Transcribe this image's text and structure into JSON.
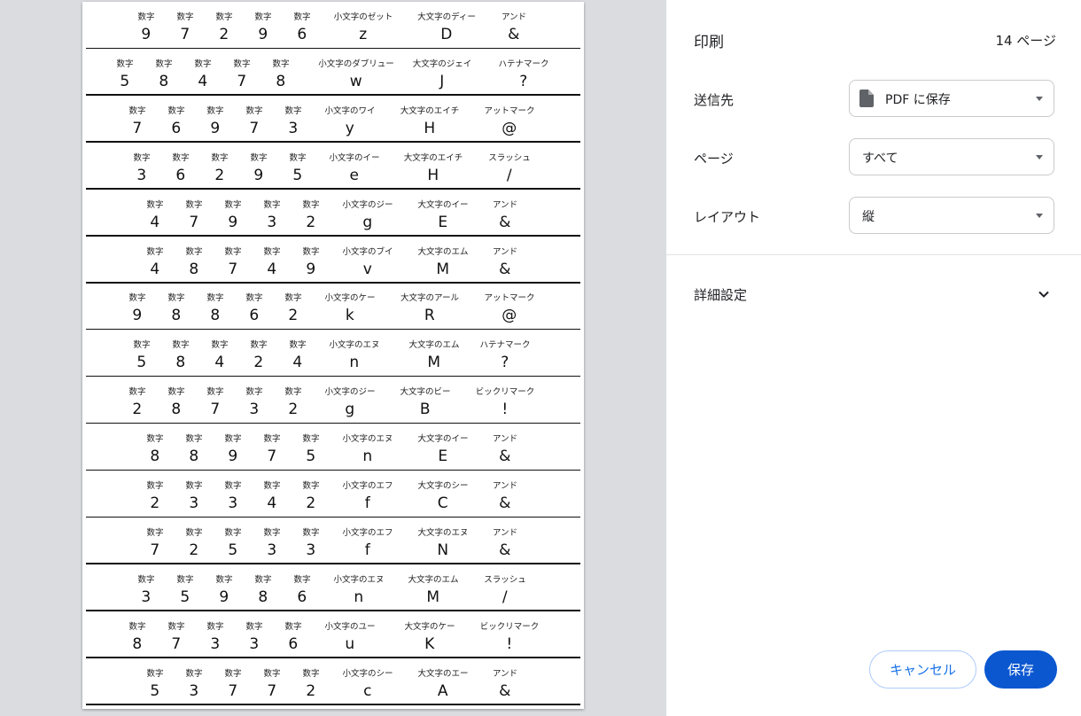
{
  "preview": {
    "rows": [
      {
        "cells": [
          {
            "label": "数字",
            "char": "9"
          },
          {
            "label": "数字",
            "char": "7"
          },
          {
            "label": "数字",
            "char": "2"
          },
          {
            "label": "数字",
            "char": "9"
          },
          {
            "label": "数字",
            "char": "6"
          },
          {
            "label": "小文字のゼット",
            "char": "z"
          },
          {
            "label": "大文字のディー",
            "char": "D"
          },
          {
            "label": "アンド",
            "char": "&"
          }
        ]
      },
      {
        "cells": [
          {
            "label": "数字",
            "char": "5"
          },
          {
            "label": "数字",
            "char": "8"
          },
          {
            "label": "数字",
            "char": "4"
          },
          {
            "label": "数字",
            "char": "7"
          },
          {
            "label": "数字",
            "char": "8"
          },
          {
            "label": "小文字のダブリュー",
            "char": "w"
          },
          {
            "label": "大文字のジェイ",
            "char": "J"
          },
          {
            "label": "ハテナマーク",
            "char": "?"
          }
        ]
      },
      {
        "cells": [
          {
            "label": "数字",
            "char": "7"
          },
          {
            "label": "数字",
            "char": "6"
          },
          {
            "label": "数字",
            "char": "9"
          },
          {
            "label": "数字",
            "char": "7"
          },
          {
            "label": "数字",
            "char": "3"
          },
          {
            "label": "小文字のワイ",
            "char": "y"
          },
          {
            "label": "大文字のエイチ",
            "char": "H"
          },
          {
            "label": "アットマーク",
            "char": "@"
          }
        ]
      },
      {
        "cells": [
          {
            "label": "数字",
            "char": "3"
          },
          {
            "label": "数字",
            "char": "6"
          },
          {
            "label": "数字",
            "char": "2"
          },
          {
            "label": "数字",
            "char": "9"
          },
          {
            "label": "数字",
            "char": "5"
          },
          {
            "label": "小文字のイー",
            "char": "e"
          },
          {
            "label": "大文字のエイチ",
            "char": "H"
          },
          {
            "label": "スラッシュ",
            "char": "/"
          }
        ]
      },
      {
        "cells": [
          {
            "label": "数字",
            "char": "4"
          },
          {
            "label": "数字",
            "char": "7"
          },
          {
            "label": "数字",
            "char": "9"
          },
          {
            "label": "数字",
            "char": "3"
          },
          {
            "label": "数字",
            "char": "2"
          },
          {
            "label": "小文字のジー",
            "char": "g"
          },
          {
            "label": "大文字のイー",
            "char": "E"
          },
          {
            "label": "アンド",
            "char": "&"
          }
        ]
      },
      {
        "cells": [
          {
            "label": "数字",
            "char": "4"
          },
          {
            "label": "数字",
            "char": "8"
          },
          {
            "label": "数字",
            "char": "7"
          },
          {
            "label": "数字",
            "char": "4"
          },
          {
            "label": "数字",
            "char": "9"
          },
          {
            "label": "小文字のブイ",
            "char": "v"
          },
          {
            "label": "大文字のエム",
            "char": "M"
          },
          {
            "label": "アンド",
            "char": "&"
          }
        ]
      },
      {
        "cells": [
          {
            "label": "数字",
            "char": "9"
          },
          {
            "label": "数字",
            "char": "8"
          },
          {
            "label": "数字",
            "char": "8"
          },
          {
            "label": "数字",
            "char": "6"
          },
          {
            "label": "数字",
            "char": "2"
          },
          {
            "label": "小文字のケー",
            "char": "k"
          },
          {
            "label": "大文字のアール",
            "char": "R"
          },
          {
            "label": "アットマーク",
            "char": "@"
          }
        ]
      },
      {
        "cells": [
          {
            "label": "数字",
            "char": "5"
          },
          {
            "label": "数字",
            "char": "8"
          },
          {
            "label": "数字",
            "char": "4"
          },
          {
            "label": "数字",
            "char": "2"
          },
          {
            "label": "数字",
            "char": "4"
          },
          {
            "label": "小文字のエヌ",
            "char": "n"
          },
          {
            "label": "大文字のエム",
            "char": "M"
          },
          {
            "label": "ハテナマーク",
            "char": "?"
          }
        ]
      },
      {
        "cells": [
          {
            "label": "数字",
            "char": "2"
          },
          {
            "label": "数字",
            "char": "8"
          },
          {
            "label": "数字",
            "char": "7"
          },
          {
            "label": "数字",
            "char": "3"
          },
          {
            "label": "数字",
            "char": "2"
          },
          {
            "label": "小文字のジー",
            "char": "g"
          },
          {
            "label": "大文字のビー",
            "char": "B"
          },
          {
            "label": "ビックリマーク",
            "char": "!"
          }
        ]
      },
      {
        "cells": [
          {
            "label": "数字",
            "char": "8"
          },
          {
            "label": "数字",
            "char": "8"
          },
          {
            "label": "数字",
            "char": "9"
          },
          {
            "label": "数字",
            "char": "7"
          },
          {
            "label": "数字",
            "char": "5"
          },
          {
            "label": "小文字のエヌ",
            "char": "n"
          },
          {
            "label": "大文字のイー",
            "char": "E"
          },
          {
            "label": "アンド",
            "char": "&"
          }
        ]
      },
      {
        "cells": [
          {
            "label": "数字",
            "char": "2"
          },
          {
            "label": "数字",
            "char": "3"
          },
          {
            "label": "数字",
            "char": "3"
          },
          {
            "label": "数字",
            "char": "4"
          },
          {
            "label": "数字",
            "char": "2"
          },
          {
            "label": "小文字のエフ",
            "char": "f"
          },
          {
            "label": "大文字のシー",
            "char": "C"
          },
          {
            "label": "アンド",
            "char": "&"
          }
        ]
      },
      {
        "cells": [
          {
            "label": "数字",
            "char": "7"
          },
          {
            "label": "数字",
            "char": "2"
          },
          {
            "label": "数字",
            "char": "5"
          },
          {
            "label": "数字",
            "char": "3"
          },
          {
            "label": "数字",
            "char": "3"
          },
          {
            "label": "小文字のエフ",
            "char": "f"
          },
          {
            "label": "大文字のエヌ",
            "char": "N"
          },
          {
            "label": "アンド",
            "char": "&"
          }
        ]
      },
      {
        "cells": [
          {
            "label": "数字",
            "char": "3"
          },
          {
            "label": "数字",
            "char": "5"
          },
          {
            "label": "数字",
            "char": "9"
          },
          {
            "label": "数字",
            "char": "8"
          },
          {
            "label": "数字",
            "char": "6"
          },
          {
            "label": "小文字のエヌ",
            "char": "n"
          },
          {
            "label": "大文字のエム",
            "char": "M"
          },
          {
            "label": "スラッシュ",
            "char": "/"
          }
        ]
      },
      {
        "cells": [
          {
            "label": "数字",
            "char": "8"
          },
          {
            "label": "数字",
            "char": "7"
          },
          {
            "label": "数字",
            "char": "3"
          },
          {
            "label": "数字",
            "char": "3"
          },
          {
            "label": "数字",
            "char": "6"
          },
          {
            "label": "小文字のユー",
            "char": "u"
          },
          {
            "label": "大文字のケー",
            "char": "K"
          },
          {
            "label": "ビックリマーク",
            "char": "!"
          }
        ]
      },
      {
        "cells": [
          {
            "label": "数字",
            "char": "5"
          },
          {
            "label": "数字",
            "char": "3"
          },
          {
            "label": "数字",
            "char": "7"
          },
          {
            "label": "数字",
            "char": "7"
          },
          {
            "label": "数字",
            "char": "2"
          },
          {
            "label": "小文字のシー",
            "char": "c"
          },
          {
            "label": "大文字のエー",
            "char": "A"
          },
          {
            "label": "アンド",
            "char": "&"
          }
        ]
      }
    ]
  },
  "panel": {
    "title": "印刷",
    "page_count": "14 ページ",
    "destination": {
      "label": "送信先",
      "value": "PDF に保存",
      "icon": "document-icon"
    },
    "pages": {
      "label": "ページ",
      "value": "すべて"
    },
    "layout": {
      "label": "レイアウト",
      "value": "縦"
    },
    "advanced": {
      "label": "詳細設定",
      "icon": "chevron-down-icon"
    },
    "cancel_label": "キャンセル",
    "save_label": "保存"
  },
  "colors": {
    "accent": "#0b57d0",
    "link": "#1a73e8",
    "preview_bg": "#dadce0"
  }
}
